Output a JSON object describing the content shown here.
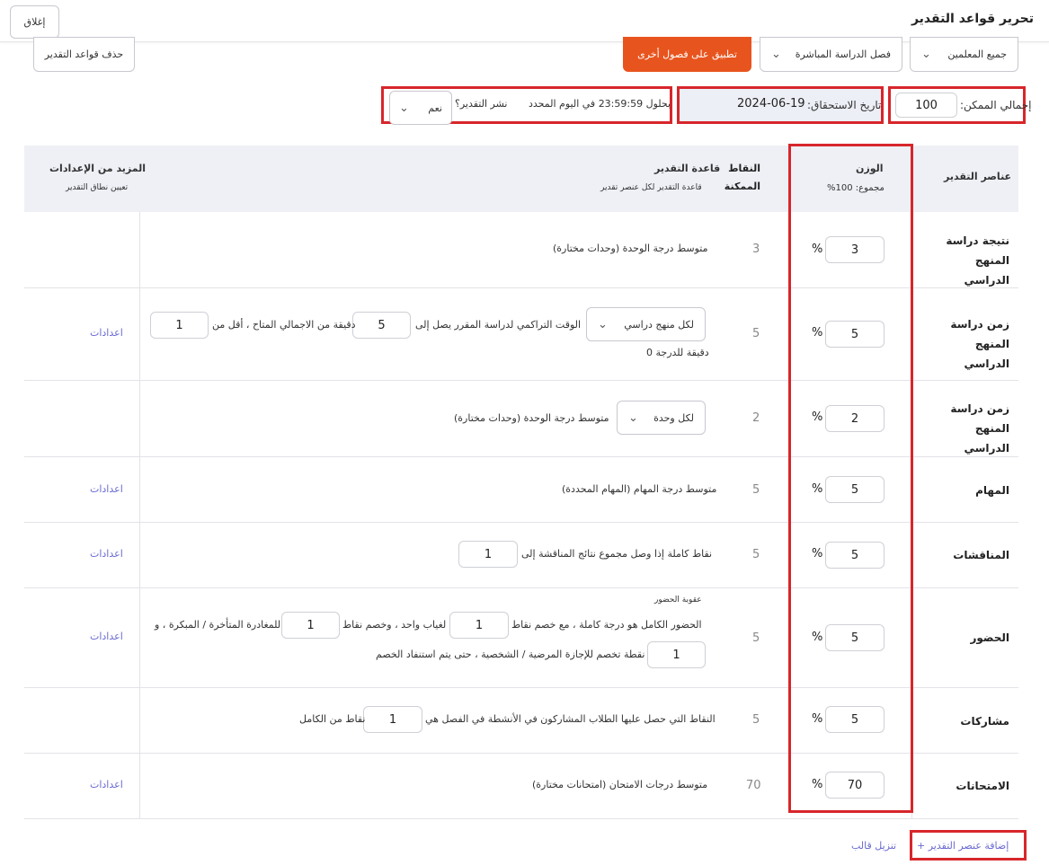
{
  "header": {
    "title": "تحرير قواعد التقدير",
    "close_label": "إغلاق"
  },
  "toolbar": {
    "delete_rules_label": "حذف قواعد التقدير",
    "apply_label": "تطبيق على فصول أخرى",
    "section_filter": "فصل الدراسة المباشرة",
    "teacher_filter": "جميع المعلمين"
  },
  "settings": {
    "total_label": "إجمالي الممكن:",
    "total_value": "100",
    "due_label": "تاريخ الاستحقاق:",
    "due_value": "2024-06-19",
    "deadline_text": "بحلول 23:59:59 في اليوم المحدد",
    "publish_label": "نشر التقدير؟",
    "publish_value": "نعم"
  },
  "table": {
    "col_element": "عناصر التقدير",
    "col_weight": "الوزن",
    "col_weight_sub": "مجموع: 100%",
    "col_points": "النقاط الممكنة",
    "col_rule": "قاعدة التقدير",
    "col_rule_sub": "قاعدة التقدير لكل عنصر تقدير",
    "col_more": "المزيد من الإعدادات",
    "col_more_sub": "تعيين نطاق التقدير",
    "percent_sign": "%",
    "rows": [
      {
        "name": "نتيجة دراسة المنهج الدراسي",
        "weight": "3",
        "points": "3",
        "rule": "متوسط درجة الوحدة (وحدات مختارة)",
        "more": ""
      },
      {
        "name": "زمن دراسة المنهج الدراسي",
        "weight": "5",
        "points": "5",
        "rule_select": "لكل منهج دراسي",
        "rule_a": "الوقت التراكمي لدراسة المقرر يصل إلى",
        "rule_val1": "5",
        "rule_b": "دقيقة من الاجمالي المتاح ، أقل من",
        "rule_val2": "1",
        "rule_c": "دقيقة للدرجة 0",
        "more": "اعدادات"
      },
      {
        "name": "زمن دراسة المنهج الدراسي",
        "weight": "2",
        "points": "2",
        "rule_select": "لكل وحدة",
        "rule": "متوسط درجة الوحدة (وحدات مختارة)",
        "more": ""
      },
      {
        "name": "المهام",
        "weight": "5",
        "points": "5",
        "rule": "متوسط درجة المهام (المهام المحددة)",
        "more": "اعدادات"
      },
      {
        "name": "المناقشات",
        "weight": "5",
        "points": "5",
        "rule": "نقاط كاملة إذا وصل مجموع نتائج المناقشة إلى",
        "rule_val1": "1",
        "more": "اعدادات"
      },
      {
        "name": "الحضور",
        "weight": "5",
        "points": "5",
        "rule_caption": "عقوبة الحضور",
        "rule_a": "الحضور الكامل هو درجة كاملة ، مع خصم نقاط",
        "rule_val1": "1",
        "rule_b": "لغياب واحد ، وخصم نقاط",
        "rule_val2": "1",
        "rule_c": "للمغادرة المتأخرة / المبكرة ، و",
        "rule_val3": "1",
        "rule_d": "نقطة تخصم للإجازة المرضية / الشخصية ، حتى يتم استنفاد الخصم",
        "more": "اعدادات"
      },
      {
        "name": "مشاركات",
        "weight": "5",
        "points": "5",
        "rule_a": "النقاط التي حصل عليها الطلاب المشاركون في الأنشطة في الفصل هي",
        "rule_val1": "1",
        "rule_b": "نقاط من الكامل",
        "more": ""
      },
      {
        "name": "الامتحانات",
        "weight": "70",
        "points": "70",
        "rule": "متوسط درجات الامتحان (امتحانات مختارة)",
        "more": "اعدادات"
      }
    ]
  },
  "footer": {
    "add_element_label": "+ إضافة عنصر التقدير",
    "download_template_label": "تنزيل قالب"
  },
  "icons": {
    "chevron": "chevron-down-icon"
  },
  "colors": {
    "accent": "#e8541e",
    "highlight_border": "#d7262b",
    "link": "#6a6ad2",
    "table_header_bg": "#eef0f6"
  }
}
